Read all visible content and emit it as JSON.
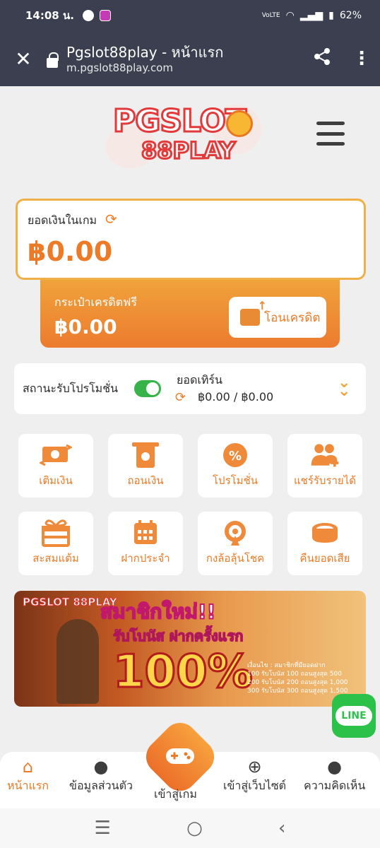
{
  "status_bar": {
    "time": "14:08 น.",
    "battery": "62%",
    "network": "VoLTE"
  },
  "browser": {
    "title": "Pgslot88play - หน้าแรก",
    "url": "m.pgslot88play.com"
  },
  "logo": {
    "line1": "PGSLOT",
    "line2": "88PLAY"
  },
  "balance": {
    "label": "ยอดเงินในเกม",
    "amount": "฿0.00"
  },
  "credit": {
    "label": "กระเป๋าเครดิตฟรี",
    "amount": "฿0.00",
    "transfer_label": "โอนเครดิต"
  },
  "promo": {
    "status_label": "สถานะรับโปรโมชั่น",
    "toggle_on": true,
    "turnover_label": "ยอดเทิร์น",
    "turnover_value": "฿0.00 / ฿0.00"
  },
  "menu": [
    {
      "label": "เติมเงิน",
      "icon": "deposit-icon"
    },
    {
      "label": "ถอนเงิน",
      "icon": "withdraw-icon"
    },
    {
      "label": "โปรโมชั่น",
      "icon": "promotion-icon"
    },
    {
      "label": "แชร์รับรายได้",
      "icon": "share-income-icon"
    },
    {
      "label": "สะสมแต้ม",
      "icon": "gift-icon"
    },
    {
      "label": "ฝากประจำ",
      "icon": "calendar-icon"
    },
    {
      "label": "กงล้อลุ้นโชค",
      "icon": "wheel-icon"
    },
    {
      "label": "คืนยอดเสีย",
      "icon": "coin-icon"
    }
  ],
  "banner": {
    "logo": "PGSLOT 88PLAY",
    "headline": "สมาชิกใหม่!!",
    "sub": "รับโบนัส ฝากครั้งแรก",
    "percent": "100%",
    "conditions": [
      "เงื่อนไข : สมาชิกที่มียอดฝาก",
      "100 รับโบนัส 100 ถอนสูงสุด 500",
      "200 รับโบนัส 200 ถอนสูงสุด 1,000",
      "300 รับโบนัส 300 ถอนสูงสุด 1,500"
    ]
  },
  "line_button": "LINE",
  "bottom_nav": [
    {
      "label": "หน้าแรก",
      "icon": "home-icon"
    },
    {
      "label": "ข้อมูลส่วนตัว",
      "icon": "profile-icon"
    },
    {
      "label": "เข้าสู่เกม",
      "icon": "gamepad-icon"
    },
    {
      "label": "เข้าสู่เว็บไซต์",
      "icon": "globe-icon"
    },
    {
      "label": "ความคิดเห็น",
      "icon": "comment-icon"
    }
  ],
  "colors": {
    "accent": "#ec7a26",
    "browser_bar": "#3b3f4f",
    "toggle": "#37b34a",
    "line": "#2cc24a"
  }
}
